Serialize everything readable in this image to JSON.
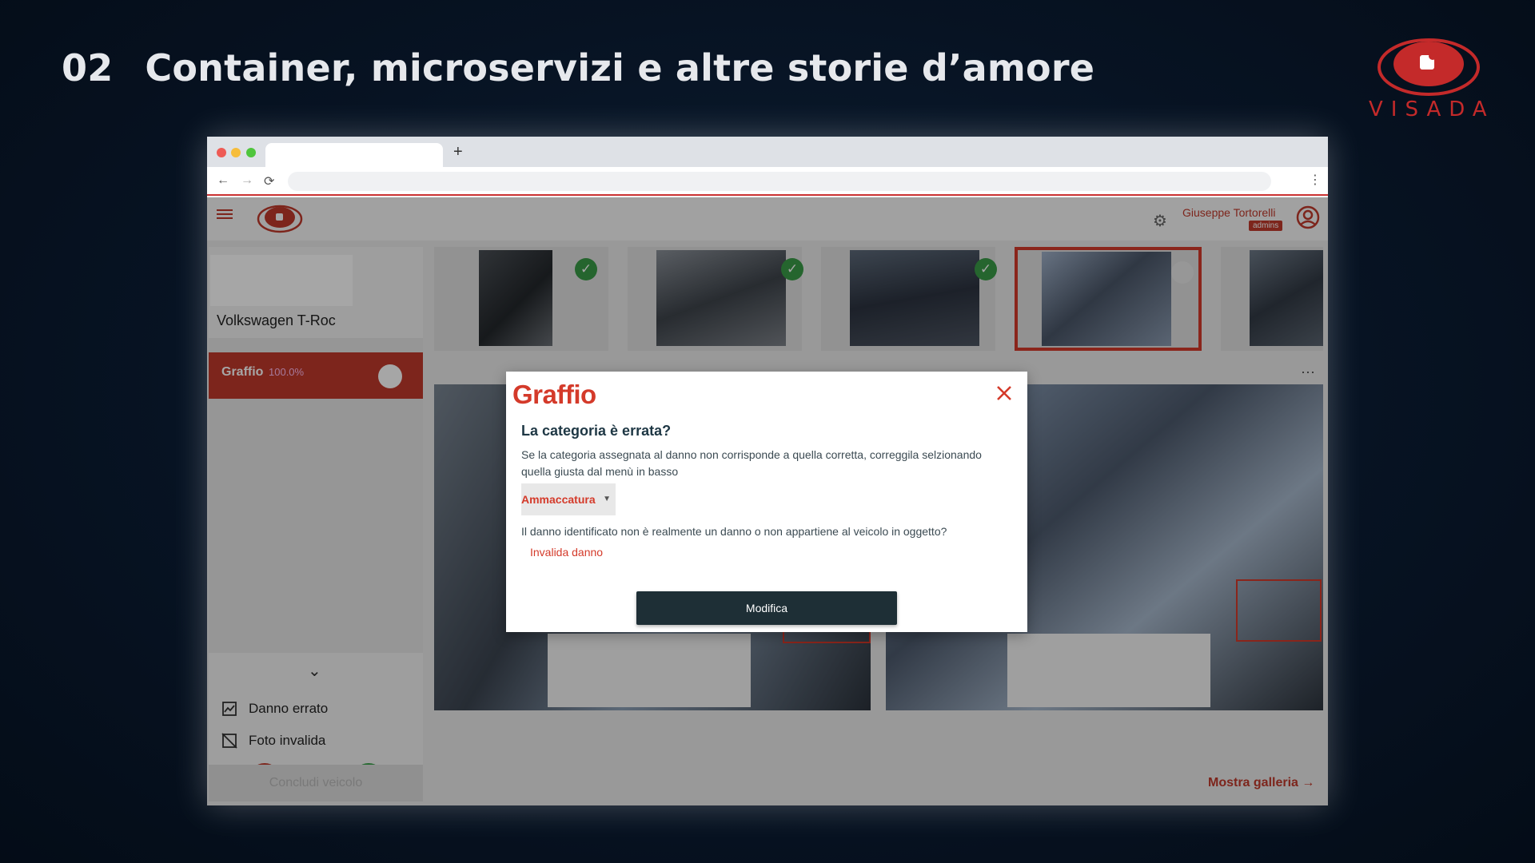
{
  "slide": {
    "number": "02",
    "title": "Container, microservizi e altre storie d’amore"
  },
  "brand": {
    "name": "VISADA",
    "color": "#c42a2a"
  },
  "browser": {
    "new_tab_label": "+",
    "nav": {
      "back": "←",
      "forward": "→",
      "reload": "⟳",
      "menu": "⋮"
    }
  },
  "app": {
    "user": {
      "name": "Giuseppe Tortorelli",
      "role": "admins"
    },
    "vehicle": {
      "name": "Volkswagen T-Roc"
    },
    "damage": {
      "label": "Graffio",
      "percent": "100.0%"
    },
    "actions": {
      "chevron": "⌄",
      "wrong_damage": "Danno errato",
      "invalid_photo": "Foto invalida",
      "reject": "✕",
      "approve": "✓",
      "conclude": "Concludi veicolo"
    },
    "thumbs_check": "✓",
    "more": "···",
    "gallery_link": "Mostra galleria →"
  },
  "modal": {
    "title": "Graffio",
    "question": "La categoria è errata?",
    "description": "Se la categoria assegnata al danno non corrisponde a quella corretta, correggila selzionando quella giusta dal menù in basso",
    "select_value": "Ammaccatura",
    "question2": "Il danno identificato non è realmente un danno o non appartiene al veicolo in oggetto?",
    "invalidate": "Invalida danno",
    "submit": "Modifica"
  }
}
